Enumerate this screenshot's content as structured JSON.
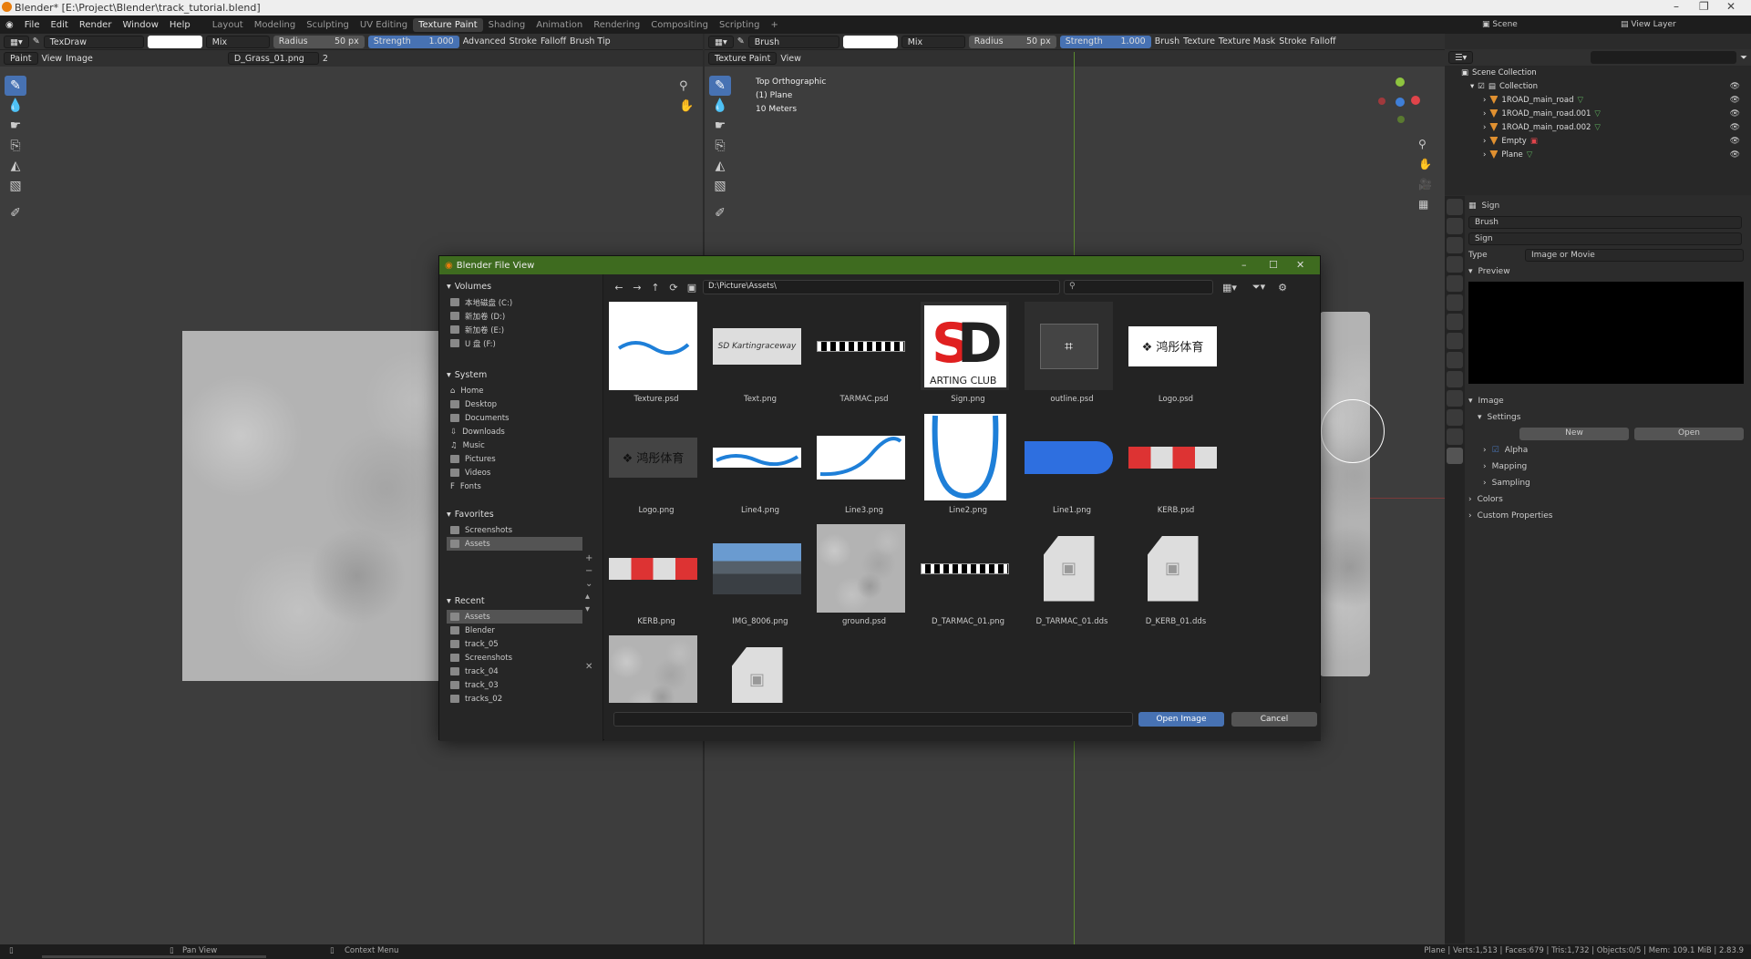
{
  "window": {
    "title": "Blender* [E:\\Project\\Blender\\track_tutorial.blend]"
  },
  "menu": {
    "items": [
      "File",
      "Edit",
      "Render",
      "Window",
      "Help"
    ]
  },
  "workspaces": [
    "Layout",
    "Modeling",
    "Sculpting",
    "UV Editing",
    "Texture Paint",
    "Shading",
    "Animation",
    "Rendering",
    "Compositing",
    "Scripting"
  ],
  "active_workspace": "Texture Paint",
  "top_right": {
    "scene": "Scene",
    "view_layer": "View Layer"
  },
  "left_header": {
    "brush": "TexDraw",
    "blend": "Mix",
    "radius": "Radius",
    "radius_val": "50 px",
    "strength": "Strength",
    "strength_val": "1.000",
    "advanced": "Advanced",
    "stroke": "Stroke",
    "falloff": "Falloff",
    "brush_tip": "Brush Tip"
  },
  "left_sub": {
    "mode": "Paint",
    "view": "View",
    "image": "Image",
    "image_name": "D_Grass_01.png",
    "users": "2"
  },
  "right_header": {
    "brush": "Brush",
    "blend": "Mix",
    "radius": "Radius",
    "radius_val": "50 px",
    "strength": "Strength",
    "strength_val": "1.000",
    "texture": "Texture",
    "texture_mask": "Texture Mask",
    "stroke": "Stroke",
    "falloff": "Falloff"
  },
  "right_sub": {
    "mode": "Texture Paint",
    "view": "View"
  },
  "viewport_info": {
    "line1": "Top Orthographic",
    "line2": "(1) Plane",
    "line3": "10 Meters"
  },
  "dialog": {
    "title": "Blender File View",
    "path": "D:\\Picture\\Assets\\",
    "sections": {
      "volumes": "Volumes",
      "system": "System",
      "favorites": "Favorites",
      "recent": "Recent"
    },
    "volumes": [
      "本地磁盘 (C:)",
      "新加卷 (D:)",
      "新加卷 (E:)",
      "U 盘 (F:)"
    ],
    "system": [
      "Home",
      "Desktop",
      "Documents",
      "Downloads",
      "Music",
      "Pictures",
      "Videos",
      "Fonts"
    ],
    "favorites": [
      "Screenshots",
      "Assets"
    ],
    "recent": [
      "Assets",
      "Blender",
      "track_05",
      "Screenshots",
      "track_04",
      "track_03",
      "tracks_02"
    ],
    "files": [
      "Texture.psd",
      "Text.png",
      "TARMAC.psd",
      "Sign.png",
      "outline.psd",
      "Logo.psd",
      "Logo.png",
      "Line4.png",
      "Line3.png",
      "Line2.png",
      "Line1.png",
      "KERB.psd",
      "KERB.png",
      "IMG_8006.png",
      "ground.psd",
      "D_TARMAC_01.png",
      "D_TARMAC_01.dds",
      "D_KERB_01.dds",
      "",
      ""
    ],
    "open_label": "Open Image",
    "cancel_label": "Cancel"
  },
  "outliner": {
    "header": "Scene Collection",
    "collection": "Collection",
    "objects": [
      "1ROAD_main_road",
      "1ROAD_main_road.001",
      "1ROAD_main_road.002",
      "Empty",
      "Plane"
    ]
  },
  "properties": {
    "context": "Sign",
    "brush": "Brush",
    "tex_name": "Sign",
    "type_label": "Type",
    "type_val": "Image or Movie",
    "preview": "Preview",
    "image": "Image",
    "settings": "Settings",
    "new": "New",
    "open": "Open",
    "alpha": "Alpha",
    "mapping": "Mapping",
    "sampling": "Sampling",
    "colors": "Colors",
    "custom": "Custom Properties"
  },
  "status": {
    "pan": "Pan View",
    "context": "Context Menu",
    "stats": "Plane | Verts:1,513 | Faces:679 | Tris:1,732 | Objects:0/5 | Mem: 109.1 MiB | 2.83.9"
  },
  "colors": {
    "accent": "#4772b3",
    "dialog_title": "#3e6b1f",
    "orange": "#e87d0d"
  }
}
